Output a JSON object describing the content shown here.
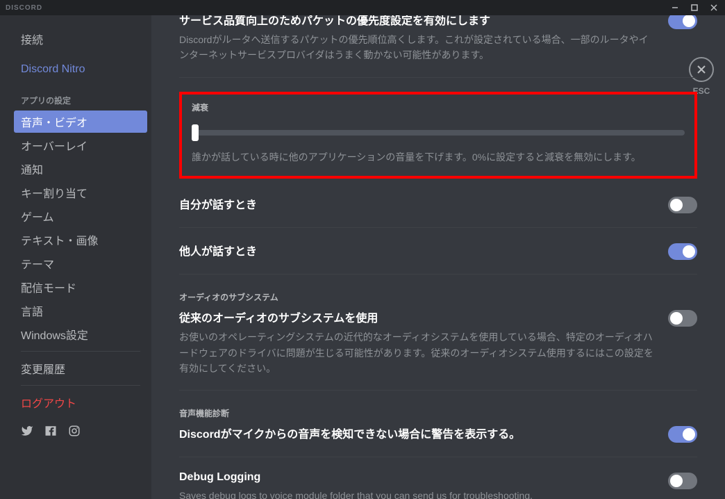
{
  "titlebar": {
    "logo": "DISCORD"
  },
  "sidebar": {
    "items": [
      {
        "label": "接続"
      },
      {
        "label": "Discord Nitro",
        "nitro": true
      },
      {
        "header": "アプリの設定"
      },
      {
        "label": "音声・ビデオ",
        "active": true
      },
      {
        "label": "オーバーレイ"
      },
      {
        "label": "通知"
      },
      {
        "label": "キー割り当て"
      },
      {
        "label": "ゲーム"
      },
      {
        "label": "テキスト・画像"
      },
      {
        "label": "テーマ"
      },
      {
        "label": "配信モード"
      },
      {
        "label": "言語"
      },
      {
        "label": "Windows設定"
      },
      {
        "sep": true
      },
      {
        "label": "変更履歴"
      },
      {
        "sep": true
      },
      {
        "label": "ログアウト",
        "logout": true
      }
    ]
  },
  "close": {
    "esc": "ESC"
  },
  "content": {
    "qos": {
      "title": "サービス品質向上のためパケットの優先度設定を有効にします",
      "desc": "Discordがルータへ送信するパケットの優先順位高くします。これが設定されている場合、一部のルータやインターネットサービスプロバイダはうまく動かない可能性があります。",
      "on": true
    },
    "attenuation": {
      "header": "減衰",
      "desc": "誰かが話している時に他のアプリケーションの音量を下げます。0%に設定すると減衰を無効にします。",
      "value_pct": 0
    },
    "self": {
      "title": "自分が話すとき",
      "on": false
    },
    "others": {
      "title": "他人が話すとき",
      "on": true
    },
    "subsystem": {
      "header": "オーディオのサブシステム",
      "title": "従来のオーディオのサブシステムを使用",
      "desc": "お使いのオペレーティングシステムの近代的なオーディオシステムを使用している場合、特定のオーディオハードウェアのドライバに問題が生じる可能性があります。従来のオーディオシステム使用するにはこの設定を有効にしてください。",
      "on": false
    },
    "diag": {
      "header": "音声機能診断",
      "title": "Discordがマイクからの音声を検知できない場合に警告を表示する。",
      "on": true
    },
    "debug": {
      "title": "Debug Logging",
      "desc": "Saves debug logs to voice module folder that you can send us for troubleshooting.",
      "on": false
    }
  }
}
